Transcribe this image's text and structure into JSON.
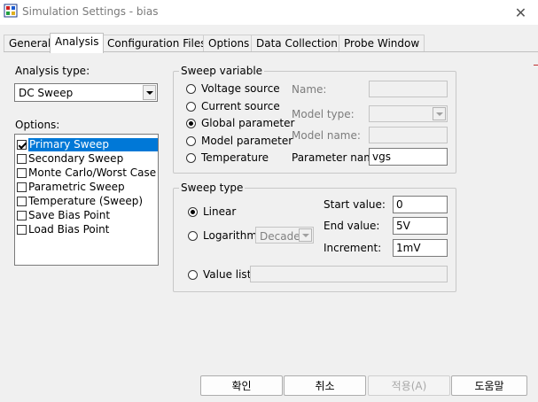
{
  "window": {
    "title": "Simulation Settings - bias",
    "close_glyph": "✕"
  },
  "tabs": [
    {
      "label": "General"
    },
    {
      "label": "Analysis"
    },
    {
      "label": "Configuration Files"
    },
    {
      "label": "Options"
    },
    {
      "label": "Data Collection"
    },
    {
      "label": "Probe Window"
    }
  ],
  "analysis": {
    "analysis_type_label": "Analysis type:",
    "analysis_type_value": "DC Sweep",
    "options_label": "Options:",
    "options": [
      {
        "label": "Primary Sweep",
        "checked": true,
        "selected": true
      },
      {
        "label": "Secondary Sweep",
        "checked": false
      },
      {
        "label": "Monte Carlo/Worst Case",
        "checked": false
      },
      {
        "label": "Parametric Sweep",
        "checked": false
      },
      {
        "label": "Temperature (Sweep)",
        "checked": false
      },
      {
        "label": "Save Bias Point",
        "checked": false
      },
      {
        "label": "Load Bias Point",
        "checked": false
      }
    ]
  },
  "sweep_variable": {
    "title": "Sweep variable",
    "radios": [
      {
        "label": "Voltage source",
        "selected": false
      },
      {
        "label": "Current source",
        "selected": false
      },
      {
        "label": "Global parameter",
        "selected": true
      },
      {
        "label": "Model parameter",
        "selected": false
      },
      {
        "label": "Temperature",
        "selected": false
      }
    ],
    "name_label": "Name:",
    "name_value": "",
    "model_type_label": "Model type:",
    "model_type_value": "",
    "model_name_label": "Model name:",
    "model_name_value": "",
    "parameter_name_label": "Parameter name:",
    "parameter_name_value": "vgs"
  },
  "sweep_type": {
    "title": "Sweep type",
    "linear_label": "Linear",
    "linear_selected": true,
    "log_label": "Logarithmic",
    "log_selected": false,
    "log_scale_value": "Decade",
    "start_label": "Start value:",
    "start_value": "0",
    "end_label": "End value:",
    "end_value": "5V",
    "increment_label": "Increment:",
    "increment_value": "1mV",
    "value_list_label": "Value list",
    "value_list_selected": false,
    "value_list_value": ""
  },
  "buttons": {
    "ok": "확인",
    "cancel": "취소",
    "apply": "적용(A)",
    "help": "도움말"
  },
  "colors": {
    "selection": "#0078d7",
    "window_bg": "#f0f0f0"
  }
}
